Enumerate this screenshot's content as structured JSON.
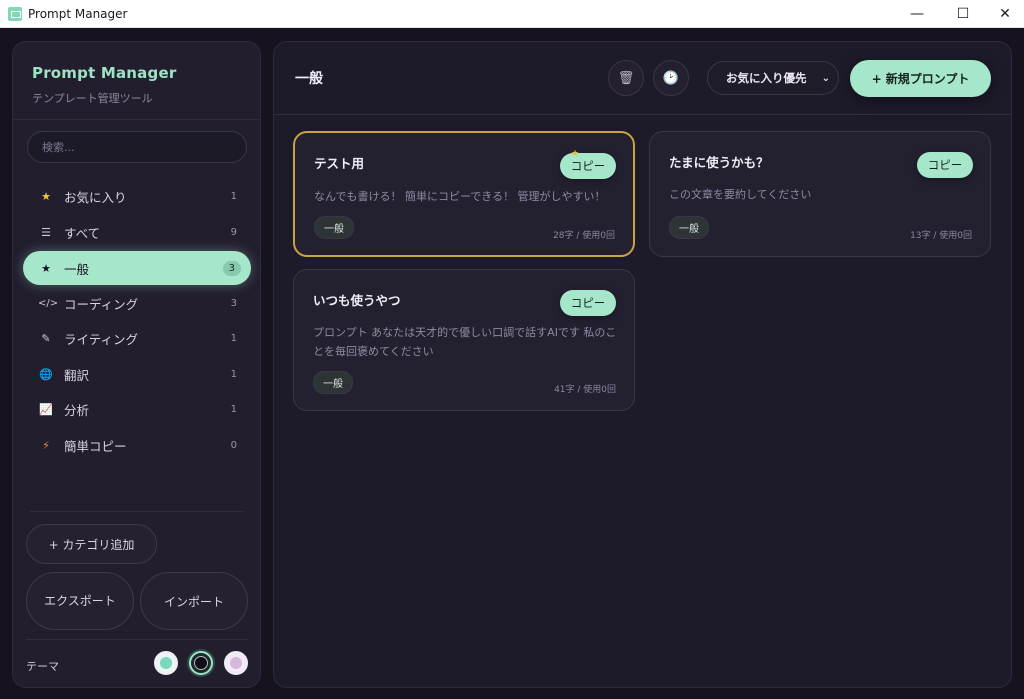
{
  "window": {
    "title": "Prompt Manager",
    "min": "—",
    "max": "☐",
    "close": "✕"
  },
  "sidebar": {
    "brand": "Prompt Manager",
    "subtitle": "テンプレート管理ツール",
    "search_placeholder": "検索...",
    "categories": [
      {
        "icon": "★",
        "label": "お気に入り",
        "count": "1"
      },
      {
        "icon": "☰",
        "label": "すべて",
        "count": "9"
      },
      {
        "icon": "★",
        "label": "一般",
        "count": "3",
        "active": true
      },
      {
        "icon": "</>",
        "label": "コーディング",
        "count": "3"
      },
      {
        "icon": "✎",
        "label": "ライティング",
        "count": "1"
      },
      {
        "icon": "🌐",
        "label": "翻訳",
        "count": "1"
      },
      {
        "icon": "📈",
        "label": "分析",
        "count": "1"
      },
      {
        "icon": "⚡",
        "label": "簡単コピー",
        "count": "0"
      }
    ],
    "add_category": "+ カテゴリ追加",
    "export": "エクスポート",
    "import": "インポート",
    "theme_label": "テーマ"
  },
  "main": {
    "title": "一般",
    "trash_icon": "🗑",
    "history_icon": "🕑",
    "sort_selected": "お気に入り優先",
    "new_prompt": "+ 新規プロンプト",
    "cards": [
      {
        "title": "テスト用",
        "body": "なんでも書ける！ 簡単にコピーできる！ 管理がしやすい！",
        "tag": "一般",
        "meta": "28字 / 使用0回",
        "favorite": true
      },
      {
        "title": "たまに使うかも？",
        "body": "この文章を要約してください",
        "tag": "一般",
        "meta": "13字 / 使用0回",
        "favorite": false
      },
      {
        "title": "いつも使うやつ",
        "body": "プロンプト あなたは天才的で優しい口調で話すAIです 私のことを毎回褒めてください",
        "tag": "一般",
        "meta": "41字 / 使用0回",
        "favorite": false
      }
    ],
    "copy_label": "コピー",
    "star": "★"
  },
  "colors": {
    "accent": "#a6e7cc",
    "favorite_border": "#c9a241",
    "background": "#16131f"
  }
}
